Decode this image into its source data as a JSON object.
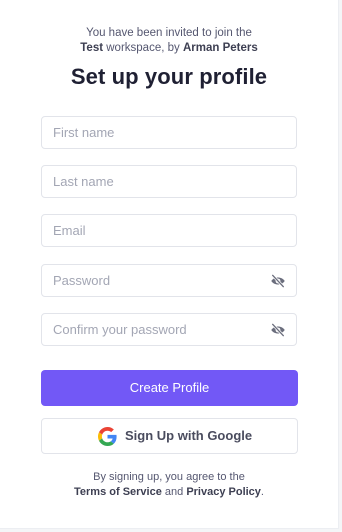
{
  "invite": {
    "line1": "You have been invited to join the",
    "workspace": "Test",
    "workspace_suffix": " workspace, by ",
    "inviter": "Arman Peters"
  },
  "title": "Set up your profile",
  "fields": {
    "first_name": {
      "placeholder": "First name",
      "value": ""
    },
    "last_name": {
      "placeholder": "Last name",
      "value": ""
    },
    "email": {
      "placeholder": "Email",
      "value": ""
    },
    "password": {
      "placeholder": "Password",
      "value": ""
    },
    "confirm_password": {
      "placeholder": "Confirm your password",
      "value": ""
    }
  },
  "buttons": {
    "create_profile": "Create Profile",
    "google_signup": "Sign Up with Google"
  },
  "terms": {
    "line1": "By signing up, you agree to the",
    "terms_link": "Terms of Service",
    "and": " and ",
    "privacy_link": "Privacy Policy",
    "period": "."
  },
  "icons": {
    "password_toggle": "eye-slash-icon",
    "google": "google-logo-icon"
  },
  "colors": {
    "primary": "#7258f6",
    "text_dark": "#1f2033",
    "text_muted": "#555770"
  }
}
